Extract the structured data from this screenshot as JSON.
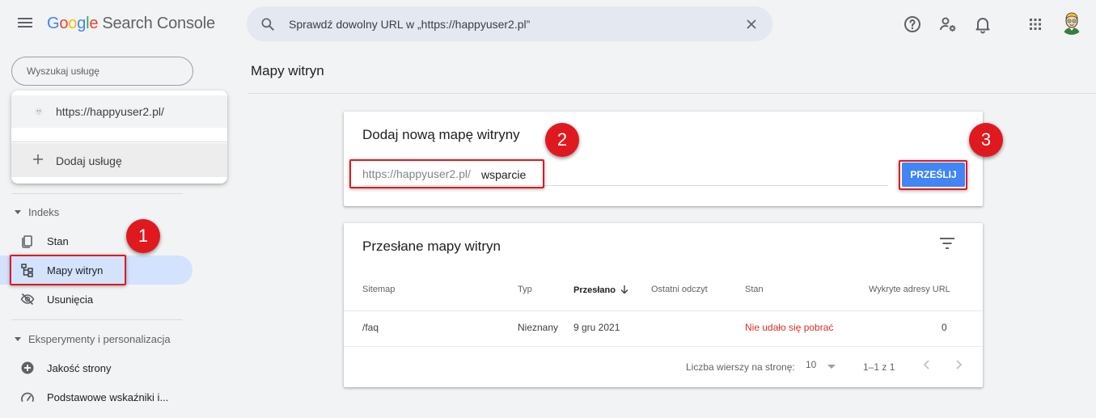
{
  "header": {
    "logo_letters": [
      "G",
      "o",
      "o",
      "g",
      "l",
      "e"
    ],
    "product": "Search Console",
    "search_placeholder": "Sprawdź dowolny URL w „https://happyuser2.pl”"
  },
  "sidebar": {
    "property_search_placeholder": "Wyszukaj usługę",
    "dropdown": {
      "selected_property": "https://happyuser2.pl/",
      "add_property": "Dodaj usługę"
    },
    "sections": [
      {
        "title": "Indeks",
        "items": [
          {
            "label": "Stan",
            "icon": "pages-icon"
          },
          {
            "label": "Mapy witryn",
            "icon": "sitemap-icon",
            "active": true
          },
          {
            "label": "Usunięcia",
            "icon": "visibility-off-icon"
          }
        ]
      },
      {
        "title": "Eksperymenty i personalizacja",
        "items": [
          {
            "label": "Jakość strony",
            "icon": "plus-circle-icon"
          },
          {
            "label": "Podstawowe wskaźniki i...",
            "icon": "speed-gauge-icon"
          }
        ]
      }
    ]
  },
  "main": {
    "page_title": "Mapy witryn",
    "add_sitemap": {
      "title": "Dodaj nową mapę witryny",
      "url_prefix": "https://happyuser2.pl/",
      "input_value": "wsparcie",
      "submit_label": "PRZEŚLIJ"
    },
    "submitted": {
      "title": "Przesłane mapy witryn",
      "columns": [
        "Sitemap",
        "Typ",
        "Przesłano",
        "Ostatni odczyt",
        "Stan",
        "Wykryte adresy URL"
      ],
      "sorted_column": "Przesłano",
      "rows": [
        {
          "sitemap": "/faq",
          "type": "Nieznany",
          "submitted": "9 gru 2021",
          "last_read": "",
          "status": "Nie udało się pobrać",
          "urls": "0"
        }
      ],
      "pagination": {
        "rows_per_page_label": "Liczba wierszy na stronę:",
        "rows_per_page": "10",
        "range": "1–1 z 1"
      }
    }
  },
  "annotations": [
    "1",
    "2",
    "3"
  ],
  "colors": {
    "accent": "#4285f4",
    "active_nav": "#d3e3fd",
    "error": "#d93025",
    "annotation": "#e0191f"
  }
}
